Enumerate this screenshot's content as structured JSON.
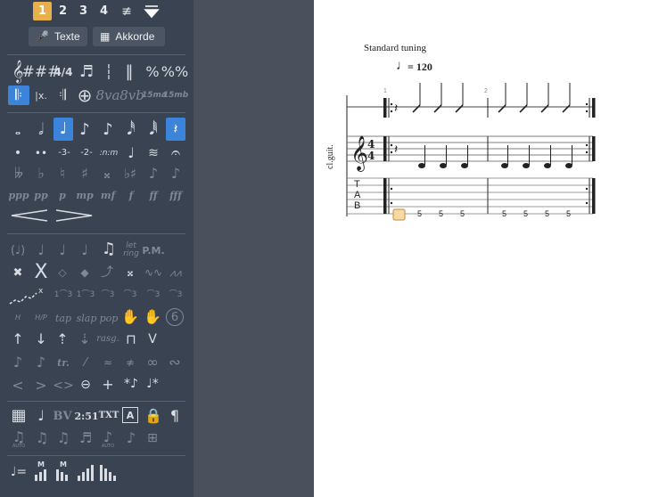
{
  "voices": [
    "1",
    "2",
    "3",
    "4"
  ],
  "buttons": {
    "lyrics": "Texte",
    "chords": "Akkorde"
  },
  "clefs_row": {
    "sharps": "###",
    "time_sig": "4/4",
    "ottava": "8va",
    "ottava_bassa": "8vb",
    "quindicesima": "15ma",
    "quindicesima_bassa": "15mb"
  },
  "notes_row": {
    "triplet": "-3-",
    "duplet": "-2-",
    "tuplet_n": ":n:m"
  },
  "dynamics": [
    "ppp",
    "pp",
    "p",
    "mp",
    "mf",
    "f",
    "ff",
    "fff"
  ],
  "effects": {
    "let_ring": "let ring",
    "pm": "P.M.",
    "tap": "tap",
    "slap": "slap",
    "pop": "pop",
    "rasg": "rasg.",
    "trill": "tr.",
    "hammer": "H",
    "hpull": "H/P",
    "harmonic_num": "6"
  },
  "tools": {
    "bv": "BV",
    "timer": "2:51",
    "txt": "TXT",
    "box_a": "A",
    "pilcrow": "¶",
    "auto": "AUTO"
  },
  "score": {
    "tuning": "Standard tuning",
    "tempo": "= 120",
    "instrument": "cl.guit.",
    "measure_numbers": [
      "1",
      "2"
    ],
    "tab_letters": [
      "T",
      "A",
      "B"
    ],
    "tab_numbers": [
      "5",
      "5",
      "5",
      "5",
      "5",
      "5",
      "5"
    ]
  }
}
